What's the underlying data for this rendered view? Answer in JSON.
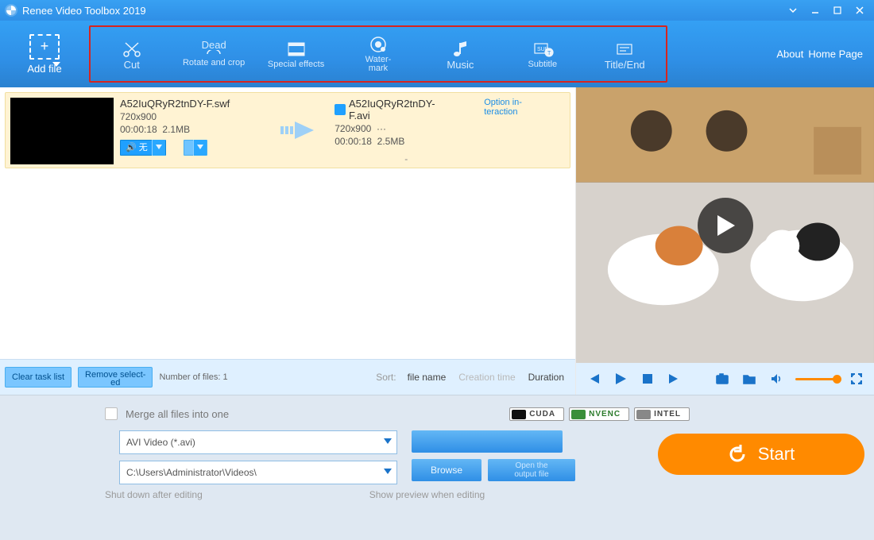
{
  "titlebar": {
    "title": "Renee Video Toolbox 2019"
  },
  "about": {
    "about": "About",
    "home": "Home Page"
  },
  "toolbar": {
    "addfile": "Add file",
    "tools": [
      {
        "key": "cut",
        "label": "Cut"
      },
      {
        "key": "rotate",
        "sup": "Dead",
        "label": "Rotate and crop"
      },
      {
        "key": "effects",
        "label": "Special effects"
      },
      {
        "key": "watermark",
        "label": "Water-\nmark"
      },
      {
        "key": "music",
        "label": "Music"
      },
      {
        "key": "subtitle",
        "label": "Subtitle"
      },
      {
        "key": "titleend",
        "label": "Title/End"
      }
    ]
  },
  "item": {
    "src": {
      "name": "A52IuQRyR2tnDY-F.swf",
      "dim": "720x900",
      "dur": "00:00:18",
      "size": "2.1MB"
    },
    "dst": {
      "name": "A52IuQRyR2tnDY-F.avi",
      "dim": "720x900",
      "dur": "00:00:18",
      "size": "2.5MB"
    },
    "option": "Option in-\nteraction",
    "chip1": "🔊 无",
    "chip2": "",
    "dash": "-"
  },
  "listfooter": {
    "clear": "Clear task list",
    "remove": "Remove select-\ned",
    "count_label": "Number of files: 1",
    "sort": "Sort:",
    "opt1": "file name",
    "opt2": "Creation time",
    "opt3": "Duration"
  },
  "bottom": {
    "merge": "Merge all files into one",
    "out_format_label": "",
    "out_format": "AVI Video (*.avi)",
    "out_folder": "C:\\Users\\Administrator\\Videos\\",
    "options": "",
    "browse": "Browse",
    "open_output": "Open the output file",
    "start": "Start",
    "shutdown": "Shut down after editing",
    "preview": "Show preview when editing",
    "gpu": {
      "cuda": "CUDA",
      "nvenc": "NVENC",
      "intel": "INTEL"
    }
  }
}
